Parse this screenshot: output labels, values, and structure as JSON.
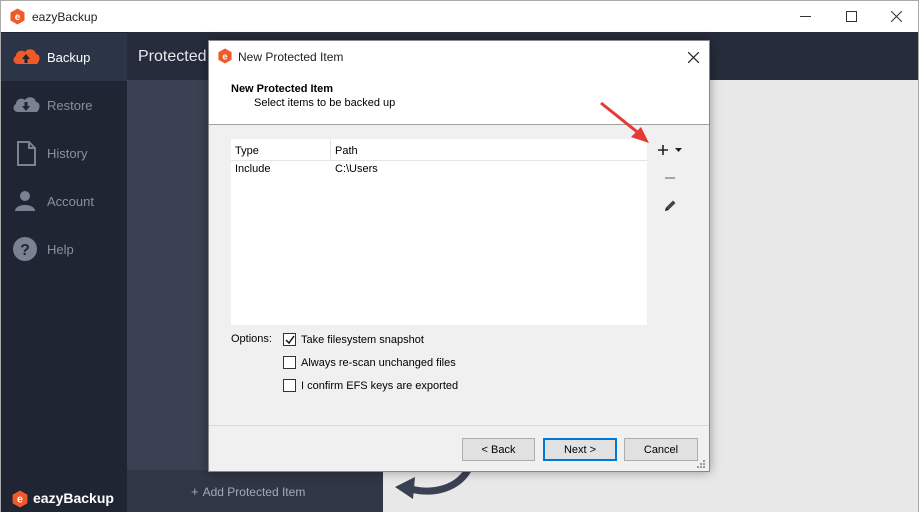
{
  "window": {
    "title": "eazyBackup"
  },
  "sidebar": {
    "items": [
      {
        "label": "Backup",
        "icon": "cloud-upload-icon"
      },
      {
        "label": "Restore",
        "icon": "cloud-download-icon"
      },
      {
        "label": "History",
        "icon": "document-icon"
      },
      {
        "label": "Account",
        "icon": "user-icon"
      },
      {
        "label": "Help",
        "icon": "help-icon"
      }
    ],
    "brand": "eazyBackup"
  },
  "panel": {
    "title": "Protected Items",
    "add_label": "Add Protected Item"
  },
  "dialog": {
    "title": "New Protected Item",
    "heading": "New Protected Item",
    "subheading": "Select items to be backed up",
    "columns": [
      "Type",
      "Path"
    ],
    "rows": [
      {
        "type": "Include",
        "path": "C:\\Users"
      }
    ],
    "options_label": "Options:",
    "options": [
      {
        "label": "Take filesystem snapshot",
        "checked": true
      },
      {
        "label": "Always re-scan unchanged files",
        "checked": false
      },
      {
        "label": "I confirm EFS keys are exported",
        "checked": false
      }
    ],
    "buttons": {
      "back": "< Back",
      "next": "Next >",
      "cancel": "Cancel"
    }
  },
  "colors": {
    "brand_orange": "#f05a28",
    "sidebar_bg": "#1f2533",
    "annotation_red": "#e53935",
    "focus_blue": "#0078d7"
  }
}
